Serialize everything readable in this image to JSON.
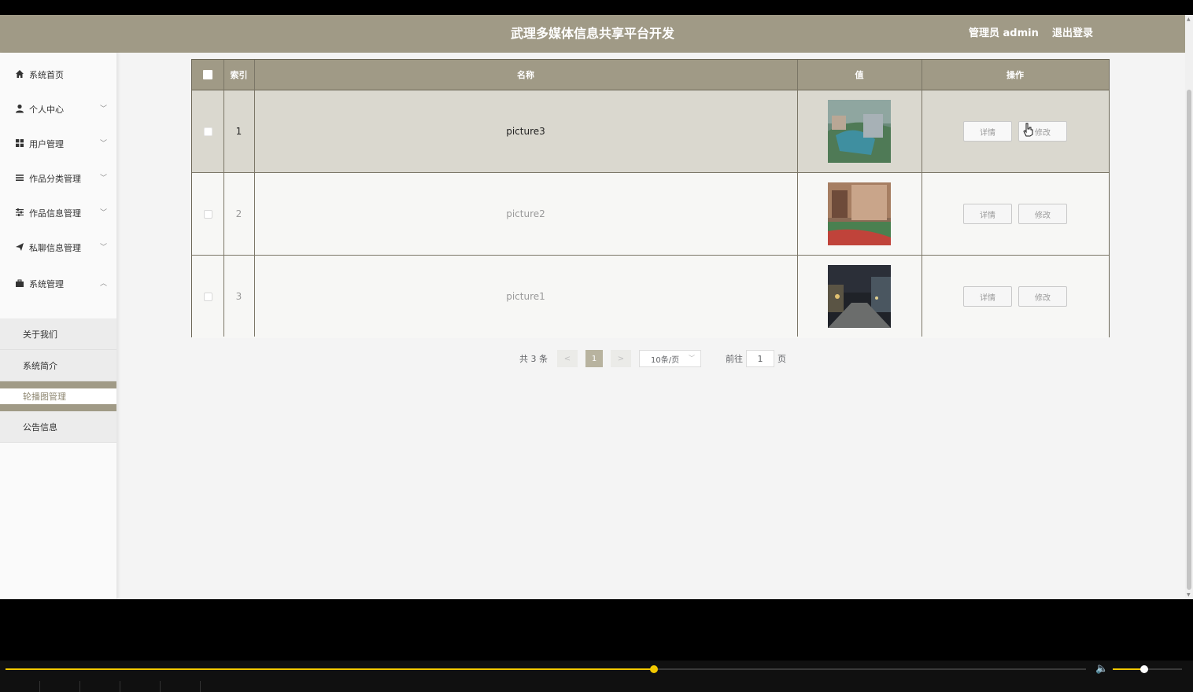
{
  "header": {
    "title": "武理多媒体信息共享平台开发",
    "user": "管理员 admin",
    "logout": "退出登录"
  },
  "sidebar": {
    "items": [
      {
        "label": "系统首页",
        "icon": "home-icon"
      },
      {
        "label": "个人中心",
        "icon": "user-icon"
      },
      {
        "label": "用户管理",
        "icon": "grid-icon"
      },
      {
        "label": "作品分类管理",
        "icon": "list-icon"
      },
      {
        "label": "作品信息管理",
        "icon": "sliders-icon"
      },
      {
        "label": "私聊信息管理",
        "icon": "send-icon"
      },
      {
        "label": "系统管理",
        "icon": "briefcase-icon"
      }
    ],
    "sub_items": [
      {
        "label": "关于我们"
      },
      {
        "label": "系统简介"
      },
      {
        "label": "轮播图管理",
        "active": true
      },
      {
        "label": "公告信息"
      }
    ]
  },
  "table": {
    "headers": {
      "index": "索引",
      "name": "名称",
      "value": "值",
      "action": "操作"
    },
    "rows": [
      {
        "index": "1",
        "name": "picture3"
      },
      {
        "index": "2",
        "name": "picture2"
      },
      {
        "index": "3",
        "name": "picture1"
      }
    ],
    "detail_label": "详情",
    "edit_label": "修改"
  },
  "pager": {
    "total": "共 3 条",
    "prev": "<",
    "current": "1",
    "next": ">",
    "page_size": "10条/页",
    "goto_prefix": "前往",
    "goto_value": "1",
    "goto_suffix": "页"
  },
  "player": {
    "progress": 0.6,
    "volume": 0.45,
    "accent": "#f2c800"
  },
  "colors": {
    "brand": "#a09a86"
  }
}
